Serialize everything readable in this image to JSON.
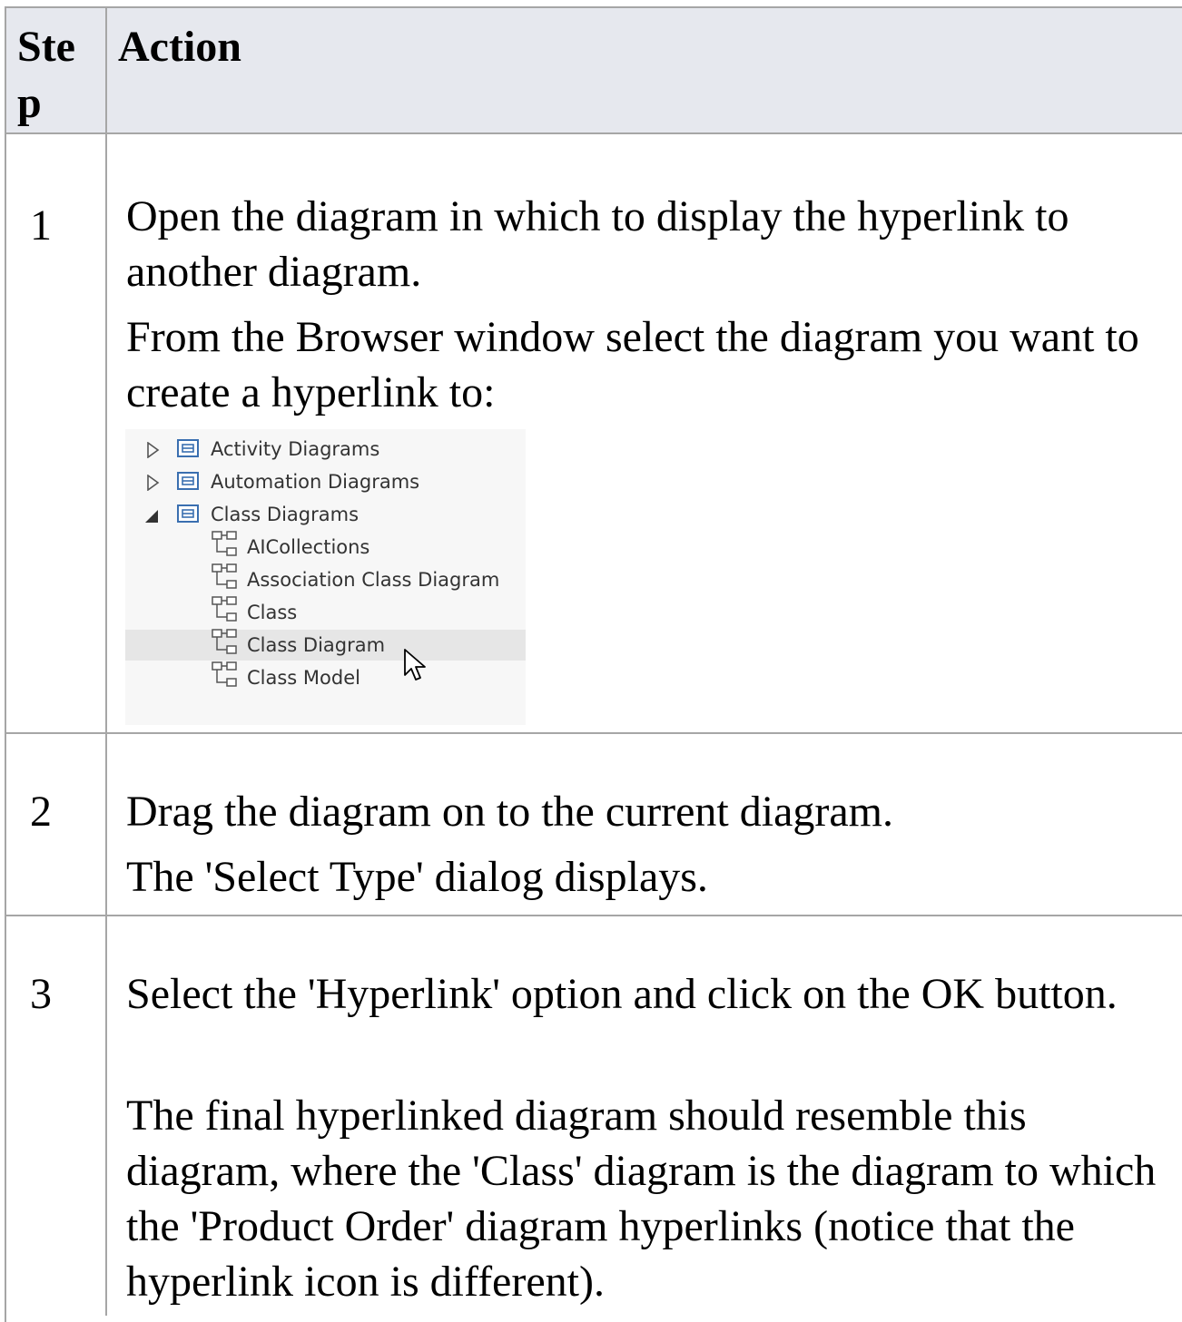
{
  "header": {
    "step": "Ste p",
    "action": "Action"
  },
  "rows": [
    {
      "step": "1",
      "paragraphs": [
        "Open the diagram in which to display the hyperlink to another diagram.",
        "From the Browser window select the diagram you want to create a hyperlink to:"
      ]
    },
    {
      "step": "2",
      "paragraphs": [
        "Drag the diagram on to the current diagram.",
        "The 'Select Type' dialog displays."
      ]
    },
    {
      "step": "3",
      "paragraphs": [
        "Select the 'Hyperlink' option and click on the OK button.",
        "The final hyperlinked diagram should resemble this diagram, where the 'Class' diagram is the diagram to which the 'Product Order' diagram hyperlinks (notice that the hyperlink icon is different)."
      ]
    }
  ],
  "browser_tree": {
    "packages": [
      {
        "label": "Activity Diagrams",
        "state": "collapsed",
        "icon": "package-icon"
      },
      {
        "label": "Automation Diagrams",
        "state": "collapsed",
        "icon": "package-icon"
      },
      {
        "label": "Class Diagrams",
        "state": "expanded",
        "icon": "package-icon"
      }
    ],
    "diagrams": [
      {
        "label": "AICollections",
        "icon": "class-diagram-icon"
      },
      {
        "label": "Association Class Diagram",
        "icon": "class-diagram-icon"
      },
      {
        "label": "Class",
        "icon": "class-diagram-icon"
      },
      {
        "label": "Class Diagram",
        "icon": "class-diagram-icon",
        "selected": true
      },
      {
        "label": "Class Model",
        "icon": "class-diagram-icon"
      }
    ]
  }
}
